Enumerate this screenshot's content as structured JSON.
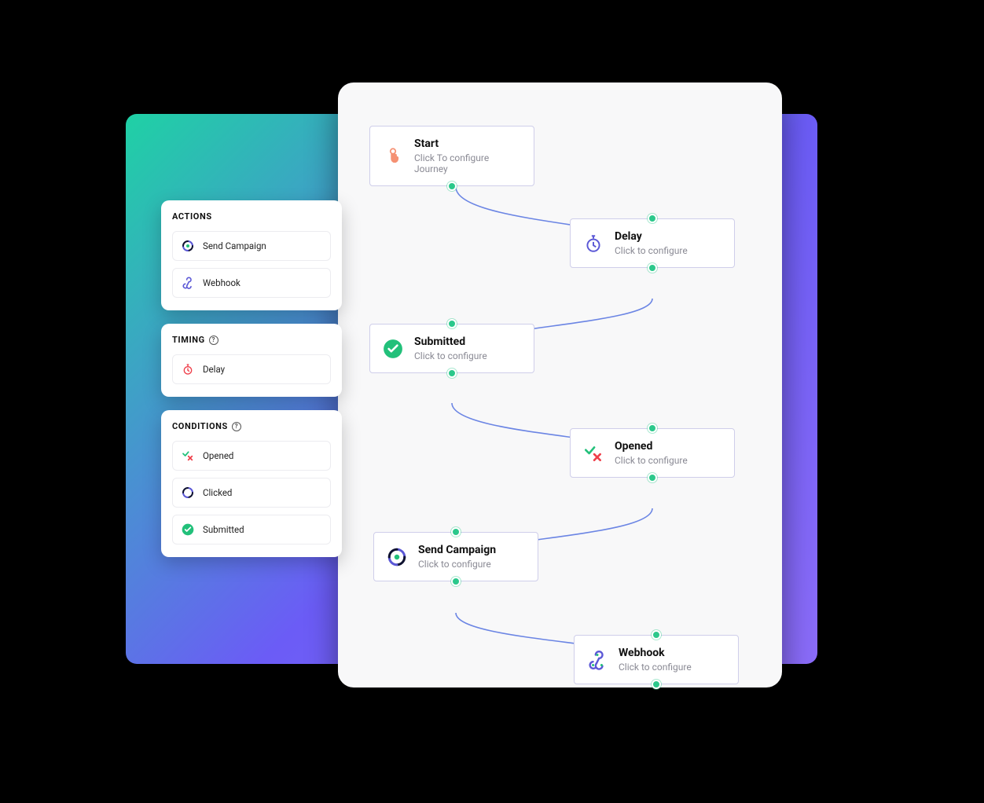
{
  "sidebar": {
    "actions": {
      "title": "ACTIONS",
      "items": [
        {
          "label": "Send Campaign"
        },
        {
          "label": "Webhook"
        }
      ]
    },
    "timing": {
      "title": "TIMING",
      "items": [
        {
          "label": "Delay"
        }
      ]
    },
    "conditions": {
      "title": "CONDITIONS",
      "items": [
        {
          "label": "Opened"
        },
        {
          "label": "Clicked"
        },
        {
          "label": "Submitted"
        }
      ]
    }
  },
  "flow": {
    "nodes": [
      {
        "id": "start",
        "title": "Start",
        "subtitle": "Click To configure Journey"
      },
      {
        "id": "delay",
        "title": "Delay",
        "subtitle": "Click to configure"
      },
      {
        "id": "submitted",
        "title": "Submitted",
        "subtitle": "Click to configure"
      },
      {
        "id": "opened",
        "title": "Opened",
        "subtitle": "Click to configure"
      },
      {
        "id": "send",
        "title": "Send Campaign",
        "subtitle": "Click to configure"
      },
      {
        "id": "webhook",
        "title": "Webhook",
        "subtitle": "Click to configure"
      }
    ]
  }
}
